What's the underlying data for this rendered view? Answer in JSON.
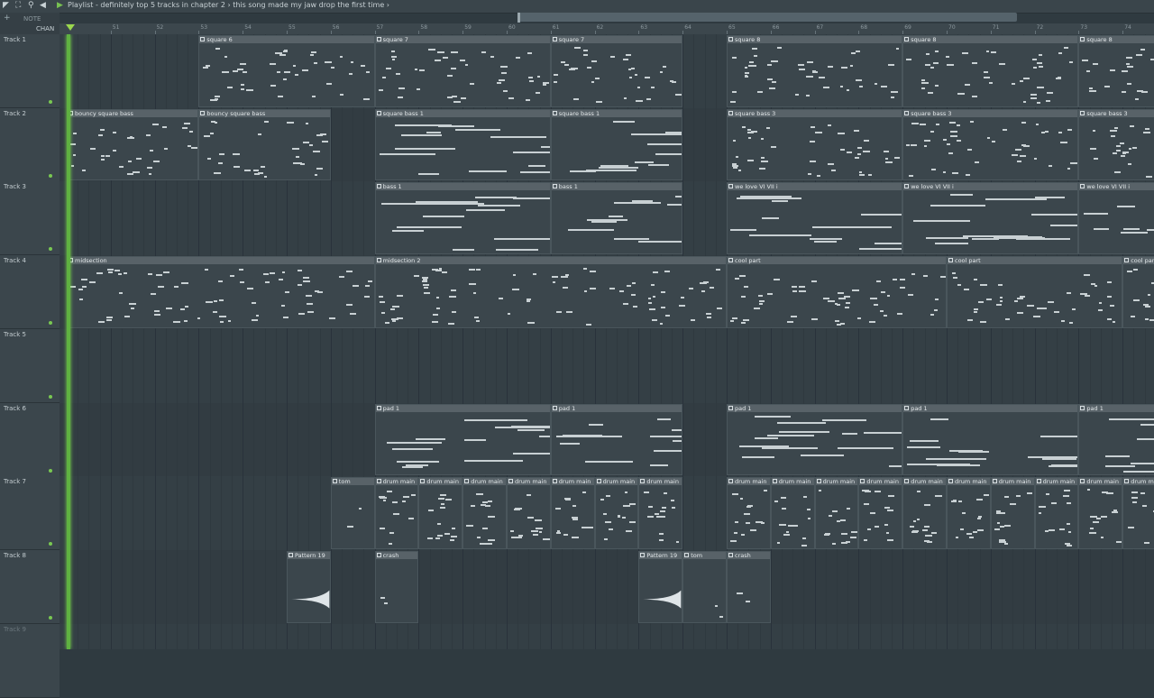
{
  "window": {
    "title": "Playlist - definitely top 5 tracks in chapter 2",
    "breadcrumb_sep": "›",
    "subtitle": "this song made my jaw drop the first time",
    "title_full": "Playlist - definitely top 5 tracks in chapter 2 › this song made my jaw drop the first time ›"
  },
  "toolbar": {
    "chan_label": "CHAN",
    "note_label": "NOTE",
    "add_label": "+"
  },
  "ruler": {
    "bars": [
      "51",
      "52",
      "53",
      "54",
      "55",
      "56",
      "57",
      "58",
      "59",
      "60",
      "61",
      "62",
      "63",
      "64",
      "65",
      "66",
      "67",
      "68",
      "69",
      "70",
      "71",
      "72",
      "73",
      "74"
    ]
  },
  "tracks": [
    {
      "name": "Track 1"
    },
    {
      "name": "Track 2"
    },
    {
      "name": "Track 3"
    },
    {
      "name": "Track 4"
    },
    {
      "name": "Track 5"
    },
    {
      "name": "Track 6"
    },
    {
      "name": "Track 7"
    },
    {
      "name": "Track 8"
    },
    {
      "name": "Track 9"
    }
  ],
  "clips": [
    {
      "track": 0,
      "bar": 53,
      "len": 4,
      "label": "square 6",
      "kind": "pattern"
    },
    {
      "track": 0,
      "bar": 57,
      "len": 4,
      "label": "square 7",
      "kind": "pattern"
    },
    {
      "track": 0,
      "bar": 61,
      "len": 3,
      "label": "square 7",
      "kind": "pattern"
    },
    {
      "track": 0,
      "bar": 65,
      "len": 4,
      "label": "square 8",
      "kind": "pattern"
    },
    {
      "track": 0,
      "bar": 69,
      "len": 4,
      "label": "square 8",
      "kind": "pattern"
    },
    {
      "track": 0,
      "bar": 73,
      "len": 2,
      "label": "square 8",
      "kind": "pattern"
    },
    {
      "track": 1,
      "bar": 50,
      "len": 3,
      "label": "bouncy square bass",
      "kind": "pattern"
    },
    {
      "track": 1,
      "bar": 53,
      "len": 3,
      "label": "bouncy square bass",
      "kind": "pattern"
    },
    {
      "track": 1,
      "bar": 57,
      "len": 4,
      "label": "square bass 1",
      "kind": "pattern"
    },
    {
      "track": 1,
      "bar": 61,
      "len": 3,
      "label": "square bass 1",
      "kind": "pattern"
    },
    {
      "track": 1,
      "bar": 65,
      "len": 4,
      "label": "square bass 3",
      "kind": "pattern"
    },
    {
      "track": 1,
      "bar": 69,
      "len": 4,
      "label": "square bass 3",
      "kind": "pattern"
    },
    {
      "track": 1,
      "bar": 73,
      "len": 2,
      "label": "square bass 3",
      "kind": "pattern"
    },
    {
      "track": 2,
      "bar": 57,
      "len": 4,
      "label": "bass 1",
      "kind": "pattern"
    },
    {
      "track": 2,
      "bar": 61,
      "len": 3,
      "label": "bass 1",
      "kind": "pattern"
    },
    {
      "track": 2,
      "bar": 65,
      "len": 4,
      "label": "we love VI VII i",
      "kind": "pattern"
    },
    {
      "track": 2,
      "bar": 69,
      "len": 4,
      "label": "we love VI VII i",
      "kind": "pattern"
    },
    {
      "track": 2,
      "bar": 73,
      "len": 2,
      "label": "we love VI VII i",
      "kind": "pattern"
    },
    {
      "track": 3,
      "bar": 50,
      "len": 7,
      "label": "midsection",
      "kind": "pattern"
    },
    {
      "track": 3,
      "bar": 57,
      "len": 8,
      "label": "midsection 2",
      "kind": "pattern"
    },
    {
      "track": 3,
      "bar": 65,
      "len": 5,
      "label": "cool part",
      "kind": "pattern"
    },
    {
      "track": 3,
      "bar": 70,
      "len": 4,
      "label": "cool part",
      "kind": "pattern"
    },
    {
      "track": 3,
      "bar": 74,
      "len": 1,
      "label": "cool part",
      "kind": "pattern"
    },
    {
      "track": 5,
      "bar": 57,
      "len": 4,
      "label": "pad 1",
      "kind": "pattern"
    },
    {
      "track": 5,
      "bar": 61,
      "len": 3,
      "label": "pad 1",
      "kind": "pattern"
    },
    {
      "track": 5,
      "bar": 65,
      "len": 4,
      "label": "pad 1",
      "kind": "pattern"
    },
    {
      "track": 5,
      "bar": 69,
      "len": 4,
      "label": "pad 1",
      "kind": "pattern"
    },
    {
      "track": 5,
      "bar": 73,
      "len": 2,
      "label": "pad 1",
      "kind": "pattern"
    },
    {
      "track": 6,
      "bar": 56,
      "len": 1,
      "label": "tom",
      "kind": "pattern"
    },
    {
      "track": 6,
      "bar": 57,
      "len": 1,
      "label": "drum main",
      "kind": "pattern"
    },
    {
      "track": 6,
      "bar": 58,
      "len": 1,
      "label": "drum main",
      "kind": "pattern"
    },
    {
      "track": 6,
      "bar": 59,
      "len": 1,
      "label": "drum main",
      "kind": "pattern"
    },
    {
      "track": 6,
      "bar": 60,
      "len": 1,
      "label": "drum main",
      "kind": "pattern"
    },
    {
      "track": 6,
      "bar": 61,
      "len": 1,
      "label": "drum main",
      "kind": "pattern"
    },
    {
      "track": 6,
      "bar": 62,
      "len": 1,
      "label": "drum main",
      "kind": "pattern"
    },
    {
      "track": 6,
      "bar": 63,
      "len": 1,
      "label": "drum main",
      "kind": "pattern"
    },
    {
      "track": 6,
      "bar": 65,
      "len": 1,
      "label": "drum main",
      "kind": "pattern"
    },
    {
      "track": 6,
      "bar": 66,
      "len": 1,
      "label": "drum main",
      "kind": "pattern"
    },
    {
      "track": 6,
      "bar": 67,
      "len": 1,
      "label": "drum main",
      "kind": "pattern"
    },
    {
      "track": 6,
      "bar": 68,
      "len": 1,
      "label": "drum main",
      "kind": "pattern"
    },
    {
      "track": 6,
      "bar": 69,
      "len": 1,
      "label": "drum main",
      "kind": "pattern"
    },
    {
      "track": 6,
      "bar": 70,
      "len": 1,
      "label": "drum main",
      "kind": "pattern"
    },
    {
      "track": 6,
      "bar": 71,
      "len": 1,
      "label": "drum main",
      "kind": "pattern"
    },
    {
      "track": 6,
      "bar": 72,
      "len": 1,
      "label": "drum main",
      "kind": "pattern"
    },
    {
      "track": 6,
      "bar": 73,
      "len": 1,
      "label": "drum main",
      "kind": "pattern"
    },
    {
      "track": 6,
      "bar": 74,
      "len": 1,
      "label": "drum main",
      "kind": "pattern"
    },
    {
      "track": 7,
      "bar": 55,
      "len": 1,
      "label": "Pattern 19",
      "kind": "audio"
    },
    {
      "track": 7,
      "bar": 57,
      "len": 1,
      "label": "crash",
      "kind": "pattern"
    },
    {
      "track": 7,
      "bar": 63,
      "len": 1,
      "label": "Pattern 19",
      "kind": "audio"
    },
    {
      "track": 7,
      "bar": 64,
      "len": 1,
      "label": "tom",
      "kind": "pattern"
    },
    {
      "track": 7,
      "bar": 65,
      "len": 1,
      "label": "crash",
      "kind": "pattern"
    }
  ],
  "colors": {
    "playhead": "#5fb241",
    "clip_header": "#586268",
    "note": "#c8d0d3",
    "background": "#333e44"
  }
}
